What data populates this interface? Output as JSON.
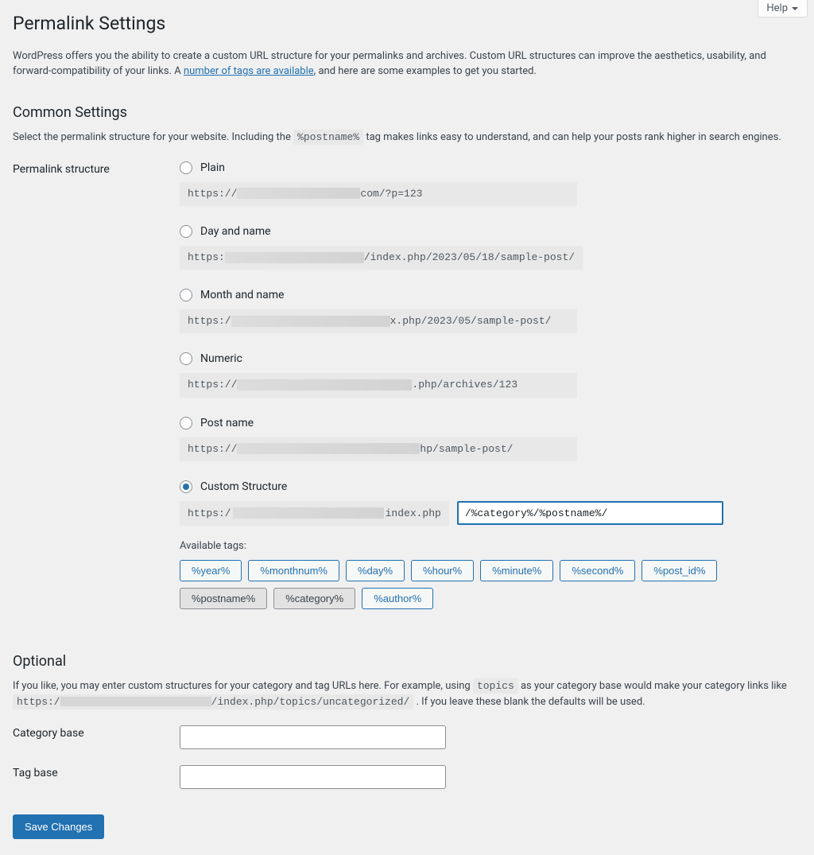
{
  "help_label": "Help",
  "page_title": "Permalink Settings",
  "intro_before_link": "WordPress offers you the ability to create a custom URL structure for your permalinks and archives. Custom URL structures can improve the aesthetics, usability, and forward-compatibility of your links. A ",
  "intro_link": "number of tags are available",
  "intro_after_link": ", and here are some examples to get you started.",
  "common_heading": "Common Settings",
  "common_desc_before": "Select the permalink structure for your website. Including the ",
  "postname_tag": "%postname%",
  "common_desc_after": " tag makes links easy to understand, and can help your posts rank higher in search engines.",
  "structure_label": "Permalink structure",
  "options": [
    {
      "label": "Plain",
      "url_prefix": "https://",
      "url_suffix": "com/?p=123"
    },
    {
      "label": "Day and name",
      "url_prefix": "https:",
      "url_suffix": "/index.php/2023/05/18/sample-post/"
    },
    {
      "label": "Month and name",
      "url_prefix": "https:/",
      "url_suffix": "x.php/2023/05/sample-post/"
    },
    {
      "label": "Numeric",
      "url_prefix": "https://",
      "url_suffix": ".php/archives/123"
    },
    {
      "label": "Post name",
      "url_prefix": "https://",
      "url_suffix": "hp/sample-post/"
    }
  ],
  "custom_label": "Custom Structure",
  "custom_prefix_left": "https:/",
  "custom_prefix_right": "index.php",
  "custom_value": "/%category%/%postname%/",
  "available_tags_label": "Available tags:",
  "tags": [
    {
      "text": "%year%",
      "used": false
    },
    {
      "text": "%monthnum%",
      "used": false
    },
    {
      "text": "%day%",
      "used": false
    },
    {
      "text": "%hour%",
      "used": false
    },
    {
      "text": "%minute%",
      "used": false
    },
    {
      "text": "%second%",
      "used": false
    },
    {
      "text": "%post_id%",
      "used": false
    },
    {
      "text": "%postname%",
      "used": true
    },
    {
      "text": "%category%",
      "used": true
    },
    {
      "text": "%author%",
      "used": false
    }
  ],
  "optional_heading": "Optional",
  "optional_desc_1": "If you like, you may enter custom structures for your category and tag URLs here. For example, using ",
  "optional_code_1": "topics",
  "optional_desc_2": " as your category base would make your category links like ",
  "optional_code_2_left": "https:/",
  "optional_code_2_right": "/index.php/topics/uncategorized/",
  "optional_desc_3": " . If you leave these blank the defaults will be used.",
  "category_base_label": "Category base",
  "category_base_value": "",
  "tag_base_label": "Tag base",
  "tag_base_value": "",
  "save_label": "Save Changes"
}
